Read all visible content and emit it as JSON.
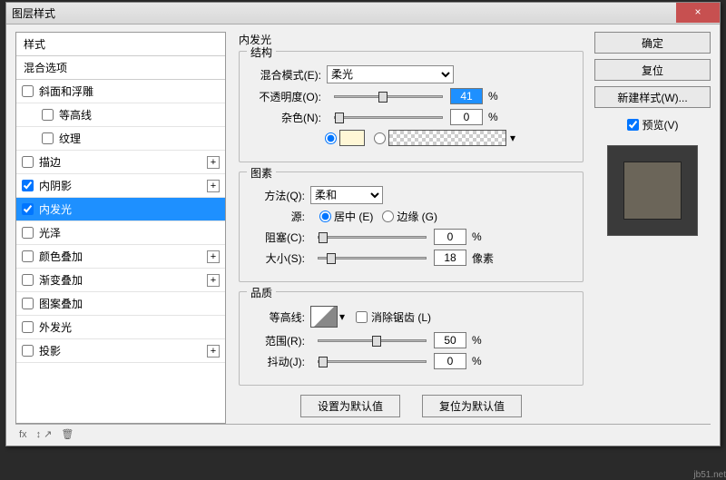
{
  "dialog": {
    "title": "图层样式"
  },
  "left": {
    "header": "样式",
    "subheader": "混合选项",
    "items": [
      {
        "label": "斜面和浮雕",
        "checked": false,
        "plus": false,
        "indent": false
      },
      {
        "label": "等高线",
        "checked": false,
        "plus": false,
        "indent": true
      },
      {
        "label": "纹理",
        "checked": false,
        "plus": false,
        "indent": true
      },
      {
        "label": "描边",
        "checked": false,
        "plus": true,
        "indent": false
      },
      {
        "label": "内阴影",
        "checked": true,
        "plus": true,
        "indent": false
      },
      {
        "label": "内发光",
        "checked": true,
        "plus": false,
        "indent": false,
        "selected": true
      },
      {
        "label": "光泽",
        "checked": false,
        "plus": false,
        "indent": false
      },
      {
        "label": "颜色叠加",
        "checked": false,
        "plus": true,
        "indent": false
      },
      {
        "label": "渐变叠加",
        "checked": false,
        "plus": true,
        "indent": false
      },
      {
        "label": "图案叠加",
        "checked": false,
        "plus": false,
        "indent": false
      },
      {
        "label": "外发光",
        "checked": false,
        "plus": false,
        "indent": false
      },
      {
        "label": "投影",
        "checked": false,
        "plus": true,
        "indent": false
      }
    ]
  },
  "mid": {
    "panel_title": "内发光",
    "struct": {
      "legend": "结构",
      "blend_label": "混合模式(E):",
      "blend_value": "柔光",
      "opacity_label": "不透明度(O):",
      "opacity_value": "41",
      "opacity_unit": "%",
      "noise_label": "杂色(N):",
      "noise_value": "0",
      "noise_unit": "%",
      "color_solid": "#fff7d6",
      "gradient_checked": false
    },
    "elements": {
      "legend": "图素",
      "method_label": "方法(Q):",
      "method_value": "柔和",
      "source_label": "源:",
      "source_center": "居中 (E)",
      "source_edge": "边缘 (G)",
      "source_sel": "center",
      "choke_label": "阻塞(C):",
      "choke_value": "0",
      "choke_unit": "%",
      "size_label": "大小(S):",
      "size_value": "18",
      "size_unit": "像素"
    },
    "quality": {
      "legend": "品质",
      "contour_label": "等高线:",
      "antialias_label": "消除锯齿 (L)",
      "antialias_checked": false,
      "range_label": "范围(R):",
      "range_value": "50",
      "range_unit": "%",
      "jitter_label": "抖动(J):",
      "jitter_value": "0",
      "jitter_unit": "%"
    },
    "buttons": {
      "default": "设置为默认值",
      "reset": "复位为默认值"
    }
  },
  "right": {
    "ok": "确定",
    "cancel": "复位",
    "newstyle": "新建样式(W)...",
    "preview_label": "预览(V)",
    "preview_checked": true
  },
  "footer": {
    "fx": "fx",
    "arrows": "↕  ↗"
  },
  "watermark": "jb51.net"
}
